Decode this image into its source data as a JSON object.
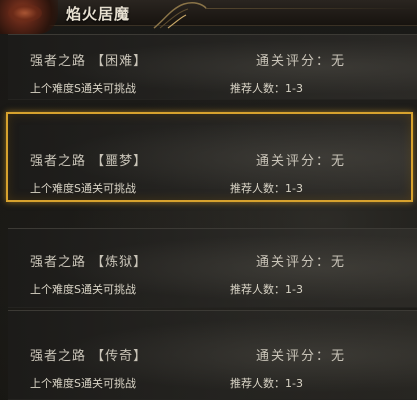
{
  "window": {
    "title": "焰火居魔"
  },
  "dungeons": [
    {
      "name": "强者之路 【困难】",
      "score_label": "通关评分：无",
      "unlock_condition": "上个难度S通关可挑战",
      "recommended": "推荐人数：1-3",
      "selected": false
    },
    {
      "name": "强者之路 【噩梦】",
      "score_label": "通关评分：无",
      "unlock_condition": "上个难度S通关可挑战",
      "recommended": "推荐人数：1-3",
      "selected": true
    },
    {
      "name": "强者之路 【炼狱】",
      "score_label": "通关评分：无",
      "unlock_condition": "上个难度S通关可挑战",
      "recommended": "推荐人数：1-3",
      "selected": false
    },
    {
      "name": "强者之路 【传奇】",
      "score_label": "通关评分：无",
      "unlock_condition": "上个难度S通关可挑战",
      "recommended": "推荐人数：1-3",
      "selected": false
    }
  ],
  "colors": {
    "selected_border": "#d7a22e",
    "text_primary": "#c9c4b8",
    "text_secondary": "#d9d4c6",
    "title_text": "#e6dfd0"
  }
}
